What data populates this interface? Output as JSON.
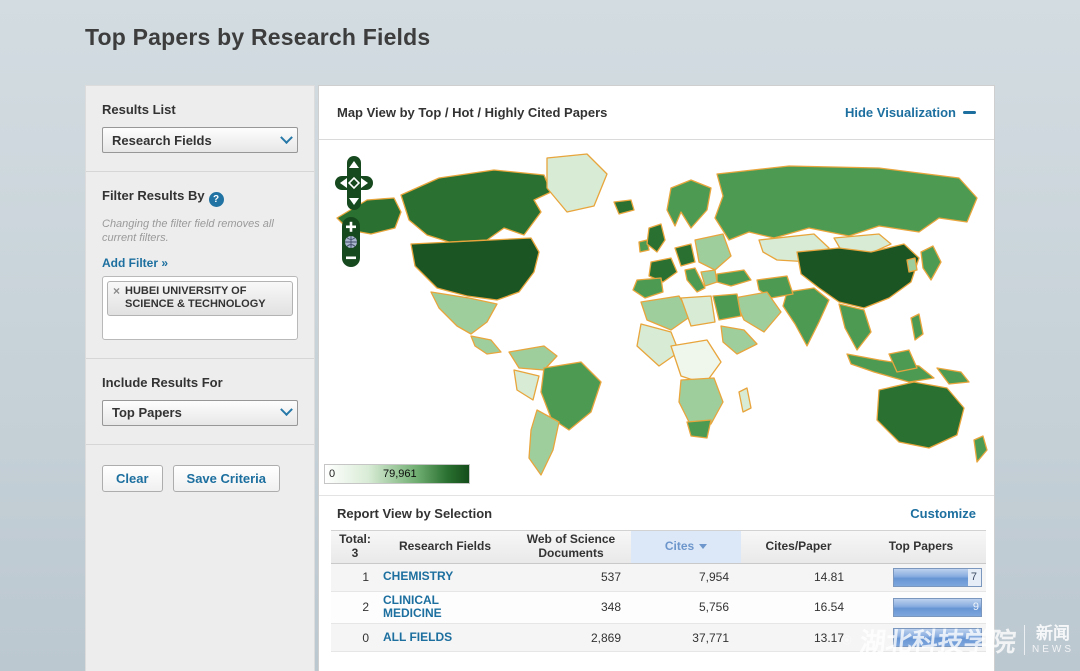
{
  "page": {
    "title": "Top Papers by Research Fields"
  },
  "sidebar": {
    "results_list": {
      "label": "Results List",
      "selected": "Research Fields"
    },
    "filter": {
      "label": "Filter Results By",
      "note": "Changing the filter field removes all current filters.",
      "add_filter": "Add Filter »",
      "tags": [
        {
          "remove_icon": "×",
          "label": "HUBEI UNIVERSITY OF SCIENCE & TECHNOLOGY"
        }
      ]
    },
    "include_results": {
      "label": "Include Results For",
      "selected": "Top Papers"
    },
    "buttons": {
      "clear": "Clear",
      "save": "Save Criteria"
    }
  },
  "visualization": {
    "title": "Map View by Top / Hot / Highly Cited Papers",
    "hide_link": "Hide Visualization",
    "legend": {
      "min": "0",
      "max": "79,961"
    },
    "map_border_color": "#E8A53C",
    "region_fills": {
      "alaska": "#2A7030",
      "canada": "#2A7030",
      "greenland": "#D8EBD4",
      "usa": "#1B5524",
      "mexico": "#9FCE9D",
      "central-america": "#9FCE9D",
      "colombia-venezuela": "#9FCE9D",
      "peru": "#D8EBD4",
      "brazil": "#4D9B53",
      "argentina-chile": "#9FCE9D",
      "iceland": "#2A7030",
      "uk": "#2A7030",
      "ireland": "#4D9B53",
      "scandinavia": "#4D9B53",
      "france": "#2A7030",
      "spain": "#4D9B53",
      "germany": "#2A7030",
      "italy": "#4D9B53",
      "eastern-europe": "#9FCE9D",
      "balkans": "#9FCE9D",
      "russia": "#4D9B53",
      "kazakhstan": "#D8EBD4",
      "mongolia": "#D8EBD4",
      "china": "#1B5524",
      "india": "#4D9B53",
      "saudi-arabia": "#9FCE9D",
      "turkey": "#4D9B53",
      "iran": "#4D9B53",
      "north-africa": "#9FCE9D",
      "libya": "#D8EBD4",
      "egypt": "#4D9B53",
      "west-africa": "#D8EBD4",
      "central-africa": "#EFF6EC",
      "horn-of-africa": "#9FCE9D",
      "southern-africa": "#9FCE9D",
      "south-africa": "#4D9B53",
      "madagascar": "#D8EBD4",
      "southeast-asia": "#4D9B53",
      "indonesia": "#4D9B53",
      "borneo": "#4D9B53",
      "philippines": "#4D9B53",
      "japan": "#4D9B53",
      "korea": "#9FCE9D",
      "papua-new-guinea": "#4D9B53",
      "australia": "#2A7030",
      "new-zealand": "#4D9B53"
    }
  },
  "report": {
    "title": "Report View by Selection",
    "customize_link": "Customize",
    "table": {
      "total_label": "Total:",
      "total_count": "3",
      "columns": {
        "field": "Research Fields",
        "documents": "Web of Science Documents",
        "cites": "Cites",
        "cites_per_paper": "Cites/Paper",
        "top_papers": "Top Papers"
      },
      "sorted_by": "Cites",
      "rows": [
        {
          "rank": "1",
          "field": "CHEMISTRY",
          "documents": "537",
          "cites": "7,954",
          "cites_per_paper": "14.81",
          "top_papers": "7",
          "bar_pct": 85
        },
        {
          "rank": "2",
          "field": "CLINICAL MEDICINE",
          "documents": "348",
          "cites": "5,756",
          "cites_per_paper": "16.54",
          "top_papers": "9",
          "bar_pct": 100
        },
        {
          "rank": "0",
          "field": "ALL FIELDS",
          "documents": "2,869",
          "cites": "37,771",
          "cites_per_paper": "13.17",
          "top_papers": "",
          "bar_pct": 100
        }
      ]
    }
  },
  "watermark": {
    "university": "湖北科技学院",
    "news_cn": "新闻",
    "news_en": "NEWS"
  },
  "colors": {
    "accent_blue": "#1C6F9F",
    "map_dark_green": "#1B5524",
    "bar_blue": "#6795D4",
    "page_bg": "#C9D4DA"
  }
}
